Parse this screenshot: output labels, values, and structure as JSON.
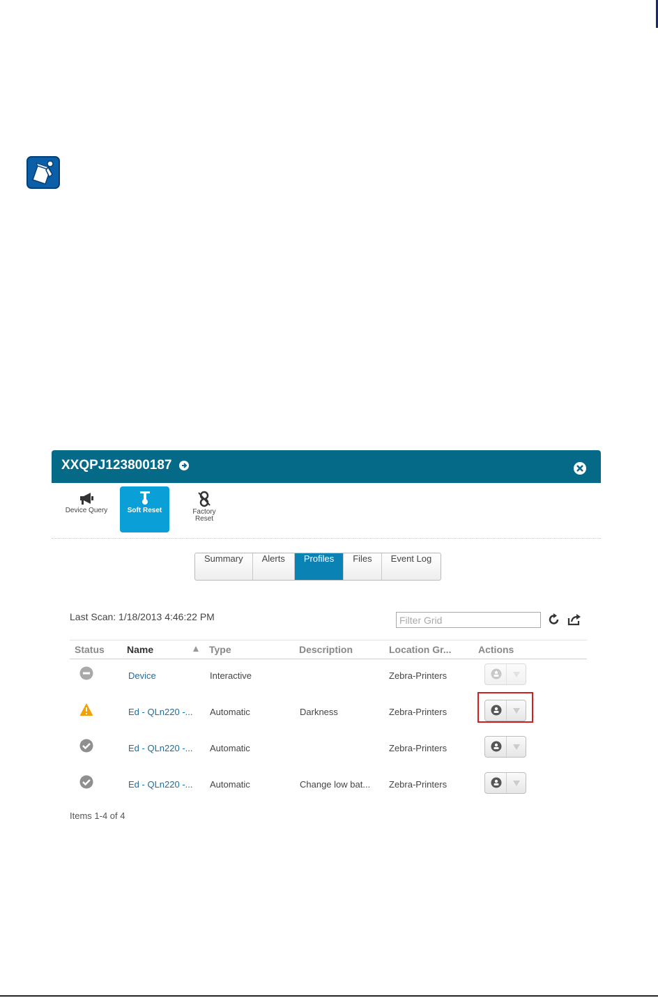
{
  "dialog": {
    "title": "XXQPJ123800187",
    "toolbar": [
      {
        "label": "Device Query",
        "icon": "megaphone-icon"
      },
      {
        "label": "Soft Reset",
        "icon": "reset-icon"
      },
      {
        "label_line1": "Factory",
        "label_line2": "Reset",
        "icon": "factory-reset-icon"
      }
    ],
    "tabs": [
      "Summary",
      "Alerts",
      "Profiles",
      "Files",
      "Event Log"
    ],
    "active_tab": "Profiles",
    "last_scan": "Last Scan: 1/18/2013 4:46:22 PM",
    "filter_placeholder": "Filter Grid",
    "columns": {
      "status": "Status",
      "name": "Name",
      "type": "Type",
      "description": "Description",
      "location": "Location Gr...",
      "actions": "Actions"
    },
    "rows": [
      {
        "status": "disabled",
        "name": "Device",
        "type": "Interactive",
        "description": "",
        "location": "Zebra-Printers"
      },
      {
        "status": "warning",
        "name": "Ed - QLn220 -...",
        "type": "Automatic",
        "description": "Darkness",
        "location": "Zebra-Printers"
      },
      {
        "status": "ok",
        "name": "Ed - QLn220 -...",
        "type": "Automatic",
        "description": "",
        "location": "Zebra-Printers"
      },
      {
        "status": "ok",
        "name": "Ed - QLn220 -...",
        "type": "Automatic",
        "description": "Change low bat...",
        "location": "Zebra-Printers"
      }
    ],
    "items_count": "Items 1-4 of 4"
  },
  "colors": {
    "titlebar": "#046a88",
    "active_tool": "#0a9fd6",
    "active_tab": "#0a82b4",
    "warning": "#f2a007",
    "highlight": "#d21e1e"
  }
}
